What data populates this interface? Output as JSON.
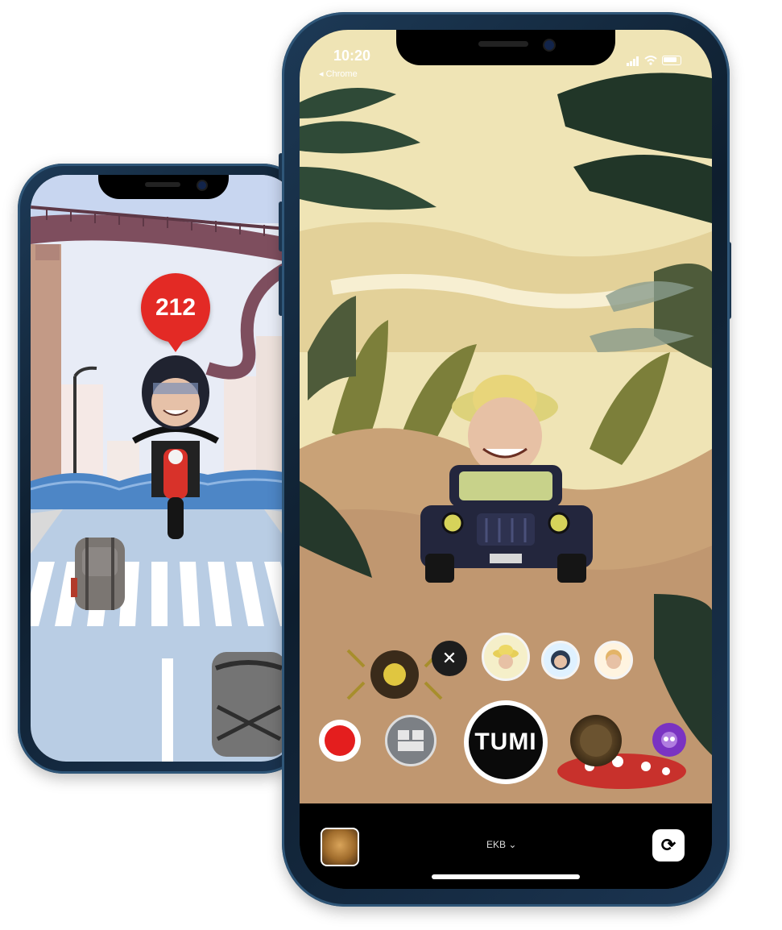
{
  "back_phone": {
    "score": "212"
  },
  "front_phone": {
    "status_bar": {
      "time": "10:20",
      "back_app": "◂ Chrome"
    },
    "effects_tray": {
      "close_symbol": "✕",
      "shutter_label": "TUMI"
    },
    "bottom_bar": {
      "camera_label": "EKB ⌄",
      "flip_symbol": "⟳"
    }
  },
  "colors": {
    "frame": "#1b3552",
    "score_red": "#e32a25",
    "record_red": "#e41e1e",
    "jungle_sky": "#efe4b5",
    "sand": "#c9a277",
    "jeep": "#23263d"
  }
}
